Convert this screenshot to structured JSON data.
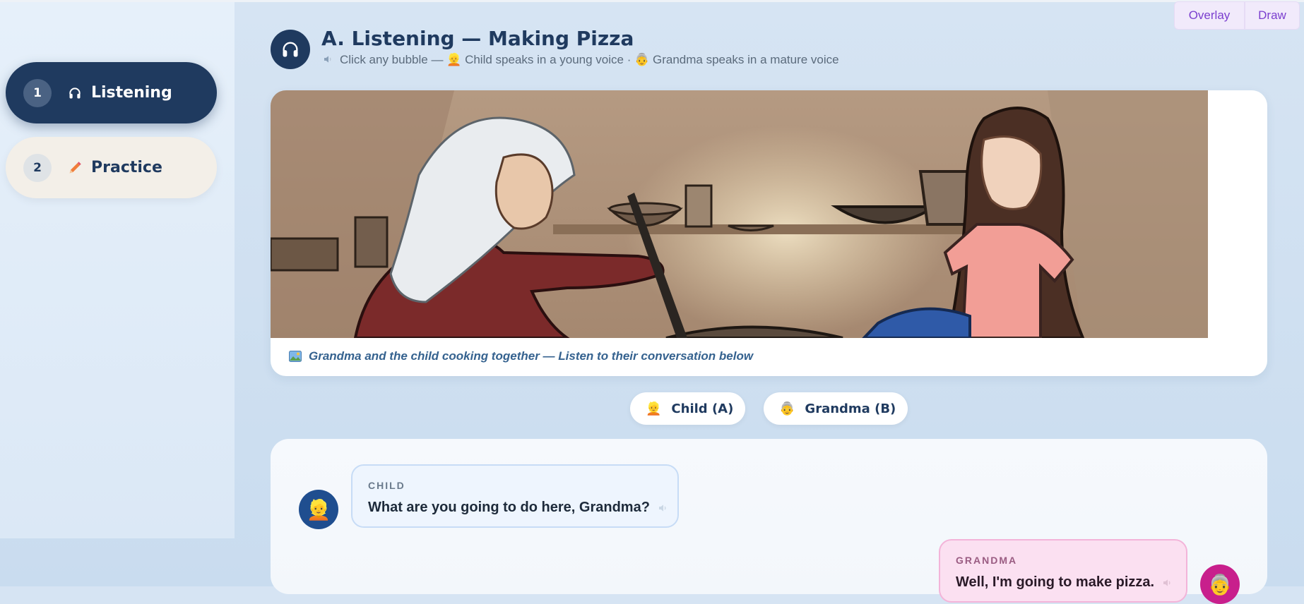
{
  "sidebar": {
    "items": [
      {
        "number": "1",
        "label": "Listening",
        "icon": "headphones-icon"
      },
      {
        "number": "2",
        "label": "Practice",
        "icon": "pencil-icon"
      }
    ]
  },
  "header": {
    "title": "A. Listening — Making Pizza",
    "subtitle": "Click any bubble — 👱 Child speaks in a young voice · 👵 Grandma speaks in a mature voice",
    "icon": "headphones-icon"
  },
  "toolbar": {
    "overlay_label": "Overlay",
    "draw_label": "Draw"
  },
  "image": {
    "caption": "Grandma and the child cooking together — Listen to their conversation below"
  },
  "speakers": {
    "child_chip": "Child (A)",
    "grandma_chip": "Grandma (B)",
    "child_emoji": "👱",
    "grandma_emoji": "👵"
  },
  "conversation": [
    {
      "speaker": "CHILD",
      "text": "What are you going to do here, Grandma?"
    },
    {
      "speaker": "GRANDMA",
      "text": "Well, I'm going to make pizza."
    }
  ],
  "colors": {
    "primary": "#1f3a5f",
    "accent_purple": "#7b3fcf",
    "child_bubble": "#eef5fe",
    "grandma_bubble": "#fbe0f1"
  }
}
